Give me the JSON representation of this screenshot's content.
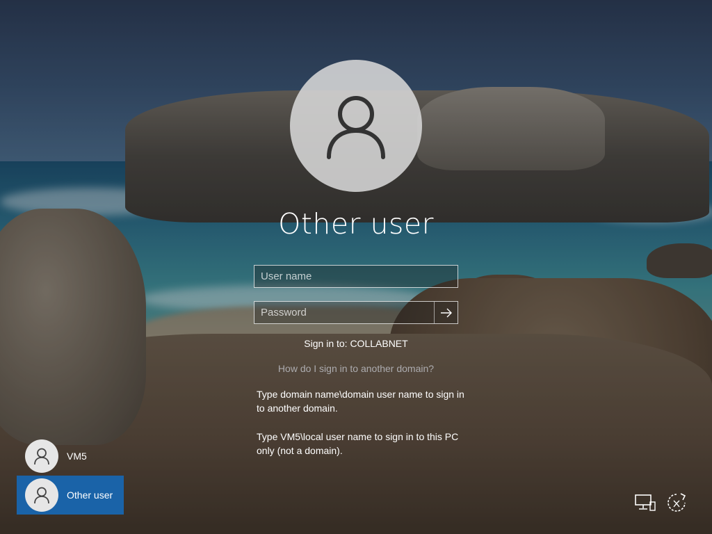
{
  "login": {
    "title": "Other user",
    "username_placeholder": "User name",
    "password_placeholder": "Password",
    "sign_in_to": "Sign in to: COLLABNET",
    "help_link": "How do I sign in to another domain?",
    "help_paragraph_1": "Type domain name\\domain user name to sign in to another domain.",
    "help_paragraph_2": "Type VM5\\local user name to sign in to this PC only (not a domain)."
  },
  "users": [
    {
      "name": "VM5",
      "selected": false
    },
    {
      "name": "Other user",
      "selected": true
    }
  ],
  "system_icons": [
    "network-icon",
    "ease-of-access-icon"
  ],
  "colors": {
    "selected_tile": "#1a63a8",
    "avatar_bg": "#d7d7d7"
  }
}
